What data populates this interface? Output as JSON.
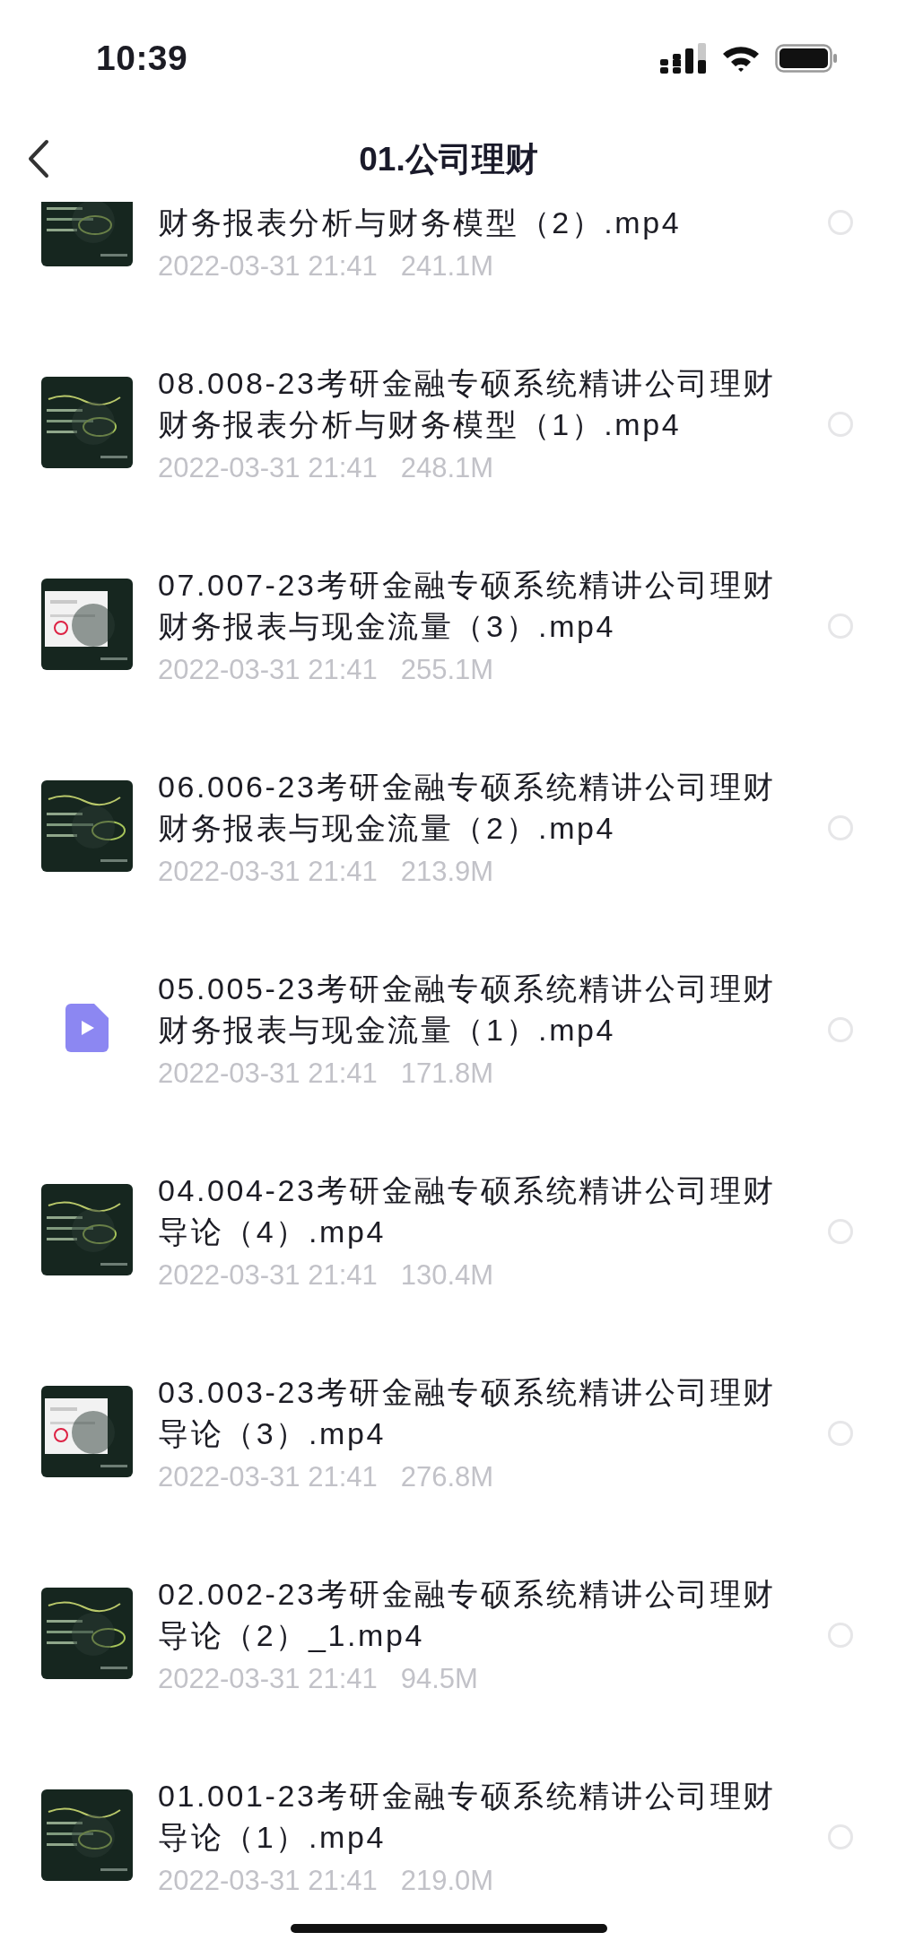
{
  "status_bar": {
    "time": "10:39"
  },
  "nav": {
    "title": "01.公司理财"
  },
  "files": [
    {
      "name_lines": [
        "财务报表分析与财务模型（2）.mp4"
      ],
      "date": "2022-03-31 21:41",
      "size": "241.1M",
      "kind": "picture",
      "selected": false
    },
    {
      "name_lines": [
        "08.008-23考研金融专硕系统精讲公司理财",
        "财务报表分析与财务模型（1）.mp4"
      ],
      "date": "2022-03-31 21:41",
      "size": "248.1M",
      "kind": "picture",
      "selected": false
    },
    {
      "name_lines": [
        "07.007-23考研金融专硕系统精讲公司理财",
        "财务报表与现金流量（3）.mp4"
      ],
      "date": "2022-03-31 21:41",
      "size": "255.1M",
      "kind": "picture",
      "selected": false
    },
    {
      "name_lines": [
        "06.006-23考研金融专硕系统精讲公司理财",
        "财务报表与现金流量（2）.mp4"
      ],
      "date": "2022-03-31 21:41",
      "size": "213.9M",
      "kind": "picture",
      "selected": false
    },
    {
      "name_lines": [
        "05.005-23考研金融专硕系统精讲公司理财",
        "财务报表与现金流量（1）.mp4"
      ],
      "date": "2022-03-31 21:41",
      "size": "171.8M",
      "kind": "video",
      "selected": false
    },
    {
      "name_lines": [
        "04.004-23考研金融专硕系统精讲公司理财",
        "导论（4）.mp4"
      ],
      "date": "2022-03-31 21:41",
      "size": "130.4M",
      "kind": "picture",
      "selected": false
    },
    {
      "name_lines": [
        "03.003-23考研金融专硕系统精讲公司理财",
        "导论（3）.mp4"
      ],
      "date": "2022-03-31 21:41",
      "size": "276.8M",
      "kind": "picture",
      "selected": false
    },
    {
      "name_lines": [
        "02.002-23考研金融专硕系统精讲公司理财",
        "导论（2）_1.mp4"
      ],
      "date": "2022-03-31 21:41",
      "size": "94.5M",
      "kind": "picture",
      "selected": false
    },
    {
      "name_lines": [
        "01.001-23考研金融专硕系统精讲公司理财",
        "导论（1）.mp4"
      ],
      "date": "2022-03-31 21:41",
      "size": "219.0M",
      "kind": "picture",
      "selected": false
    }
  ]
}
